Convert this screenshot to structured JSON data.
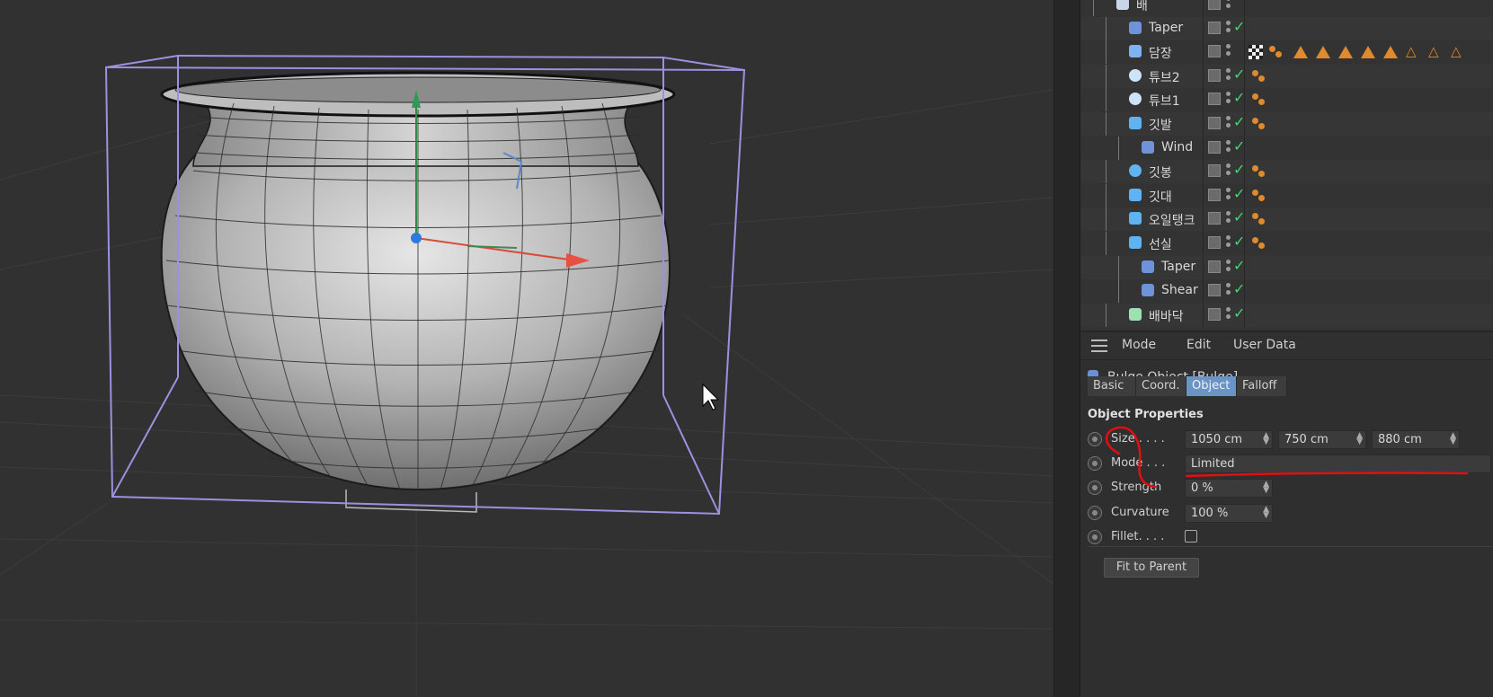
{
  "object_manager": {
    "rows": [
      {
        "name": "배",
        "icon": "null-group-icon",
        "indent": 1,
        "tags": false
      },
      {
        "name": "Taper",
        "icon": "taper-deformer-icon",
        "indent": 2,
        "tags": false
      },
      {
        "name": "담장",
        "icon": "cloner-icon",
        "indent": 2,
        "tags": true
      },
      {
        "name": "튜브2",
        "icon": "tube-icon",
        "indent": 2,
        "tags": true
      },
      {
        "name": "튜브1",
        "icon": "tube-icon",
        "indent": 2,
        "tags": true
      },
      {
        "name": "깃발",
        "icon": "cube-object-icon",
        "indent": 2,
        "tags": true
      },
      {
        "name": "Wind",
        "icon": "wind-icon",
        "indent": 3,
        "tags": false
      },
      {
        "name": "깃봉",
        "icon": "sphere-icon",
        "indent": 2,
        "tags": true
      },
      {
        "name": "깃대",
        "icon": "cylinder-icon",
        "indent": 2,
        "tags": true
      },
      {
        "name": "오일탱크",
        "icon": "oil-tank-icon",
        "indent": 2,
        "tags": true
      },
      {
        "name": "선실",
        "icon": "cube-object-icon",
        "indent": 2,
        "tags": true
      },
      {
        "name": "Taper",
        "icon": "taper-deformer-icon",
        "indent": 3,
        "tags": false
      },
      {
        "name": "Shear",
        "icon": "shear-deformer-icon",
        "indent": 3,
        "tags": false
      },
      {
        "name": "배바닥",
        "icon": "capsule-icon",
        "indent": 2,
        "tags": false
      }
    ]
  },
  "attributes": {
    "menu": [
      "Mode",
      "Edit",
      "User Data"
    ],
    "object_title": "Bulge Object [Bulge]",
    "tabs": [
      "Basic",
      "Coord.",
      "Object",
      "Falloff"
    ],
    "active_tab": "Object",
    "section_title": "Object Properties",
    "size_label": "Size . . . .",
    "size_values": [
      "1050 cm",
      "750 cm",
      "880 cm"
    ],
    "mode_label": "Mode . . .",
    "mode_value": "Limited",
    "strength_label": "Strength",
    "strength_value": "0 %",
    "curvature_label": "Curvature",
    "curvature_value": "100 %",
    "fillet_label": "Fillet. . . .",
    "fillet_checked": false,
    "fit_button": "Fit to Parent"
  },
  "colors": {
    "accent_tab": "#6a93c6",
    "check_green": "#4cd36b",
    "tag_orange": "#e08a2e",
    "bbox_lilac": "#9a92e0",
    "annotation_red": "#e01010"
  }
}
